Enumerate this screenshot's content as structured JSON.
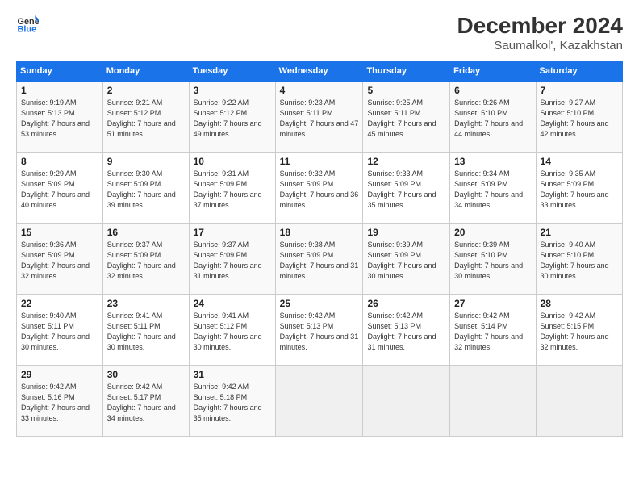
{
  "header": {
    "logo_line1": "General",
    "logo_line2": "Blue",
    "month": "December 2024",
    "location": "Saumalkol', Kazakhstan"
  },
  "weekdays": [
    "Sunday",
    "Monday",
    "Tuesday",
    "Wednesday",
    "Thursday",
    "Friday",
    "Saturday"
  ],
  "weeks": [
    [
      {
        "day": "1",
        "sunrise": "9:19 AM",
        "sunset": "5:13 PM",
        "daylight": "7 hours and 53 minutes."
      },
      {
        "day": "2",
        "sunrise": "9:21 AM",
        "sunset": "5:12 PM",
        "daylight": "7 hours and 51 minutes."
      },
      {
        "day": "3",
        "sunrise": "9:22 AM",
        "sunset": "5:12 PM",
        "daylight": "7 hours and 49 minutes."
      },
      {
        "day": "4",
        "sunrise": "9:23 AM",
        "sunset": "5:11 PM",
        "daylight": "7 hours and 47 minutes."
      },
      {
        "day": "5",
        "sunrise": "9:25 AM",
        "sunset": "5:11 PM",
        "daylight": "7 hours and 45 minutes."
      },
      {
        "day": "6",
        "sunrise": "9:26 AM",
        "sunset": "5:10 PM",
        "daylight": "7 hours and 44 minutes."
      },
      {
        "day": "7",
        "sunrise": "9:27 AM",
        "sunset": "5:10 PM",
        "daylight": "7 hours and 42 minutes."
      }
    ],
    [
      {
        "day": "8",
        "sunrise": "9:29 AM",
        "sunset": "5:09 PM",
        "daylight": "7 hours and 40 minutes."
      },
      {
        "day": "9",
        "sunrise": "9:30 AM",
        "sunset": "5:09 PM",
        "daylight": "7 hours and 39 minutes."
      },
      {
        "day": "10",
        "sunrise": "9:31 AM",
        "sunset": "5:09 PM",
        "daylight": "7 hours and 37 minutes."
      },
      {
        "day": "11",
        "sunrise": "9:32 AM",
        "sunset": "5:09 PM",
        "daylight": "7 hours and 36 minutes."
      },
      {
        "day": "12",
        "sunrise": "9:33 AM",
        "sunset": "5:09 PM",
        "daylight": "7 hours and 35 minutes."
      },
      {
        "day": "13",
        "sunrise": "9:34 AM",
        "sunset": "5:09 PM",
        "daylight": "7 hours and 34 minutes."
      },
      {
        "day": "14",
        "sunrise": "9:35 AM",
        "sunset": "5:09 PM",
        "daylight": "7 hours and 33 minutes."
      }
    ],
    [
      {
        "day": "15",
        "sunrise": "9:36 AM",
        "sunset": "5:09 PM",
        "daylight": "7 hours and 32 minutes."
      },
      {
        "day": "16",
        "sunrise": "9:37 AM",
        "sunset": "5:09 PM",
        "daylight": "7 hours and 32 minutes."
      },
      {
        "day": "17",
        "sunrise": "9:37 AM",
        "sunset": "5:09 PM",
        "daylight": "7 hours and 31 minutes."
      },
      {
        "day": "18",
        "sunrise": "9:38 AM",
        "sunset": "5:09 PM",
        "daylight": "7 hours and 31 minutes."
      },
      {
        "day": "19",
        "sunrise": "9:39 AM",
        "sunset": "5:09 PM",
        "daylight": "7 hours and 30 minutes."
      },
      {
        "day": "20",
        "sunrise": "9:39 AM",
        "sunset": "5:10 PM",
        "daylight": "7 hours and 30 minutes."
      },
      {
        "day": "21",
        "sunrise": "9:40 AM",
        "sunset": "5:10 PM",
        "daylight": "7 hours and 30 minutes."
      }
    ],
    [
      {
        "day": "22",
        "sunrise": "9:40 AM",
        "sunset": "5:11 PM",
        "daylight": "7 hours and 30 minutes."
      },
      {
        "day": "23",
        "sunrise": "9:41 AM",
        "sunset": "5:11 PM",
        "daylight": "7 hours and 30 minutes."
      },
      {
        "day": "24",
        "sunrise": "9:41 AM",
        "sunset": "5:12 PM",
        "daylight": "7 hours and 30 minutes."
      },
      {
        "day": "25",
        "sunrise": "9:42 AM",
        "sunset": "5:13 PM",
        "daylight": "7 hours and 31 minutes."
      },
      {
        "day": "26",
        "sunrise": "9:42 AM",
        "sunset": "5:13 PM",
        "daylight": "7 hours and 31 minutes."
      },
      {
        "day": "27",
        "sunrise": "9:42 AM",
        "sunset": "5:14 PM",
        "daylight": "7 hours and 32 minutes."
      },
      {
        "day": "28",
        "sunrise": "9:42 AM",
        "sunset": "5:15 PM",
        "daylight": "7 hours and 32 minutes."
      }
    ],
    [
      {
        "day": "29",
        "sunrise": "9:42 AM",
        "sunset": "5:16 PM",
        "daylight": "7 hours and 33 minutes."
      },
      {
        "day": "30",
        "sunrise": "9:42 AM",
        "sunset": "5:17 PM",
        "daylight": "7 hours and 34 minutes."
      },
      {
        "day": "31",
        "sunrise": "9:42 AM",
        "sunset": "5:18 PM",
        "daylight": "7 hours and 35 minutes."
      },
      null,
      null,
      null,
      null
    ]
  ],
  "labels": {
    "sunrise": "Sunrise:",
    "sunset": "Sunset:",
    "daylight": "Daylight:"
  }
}
